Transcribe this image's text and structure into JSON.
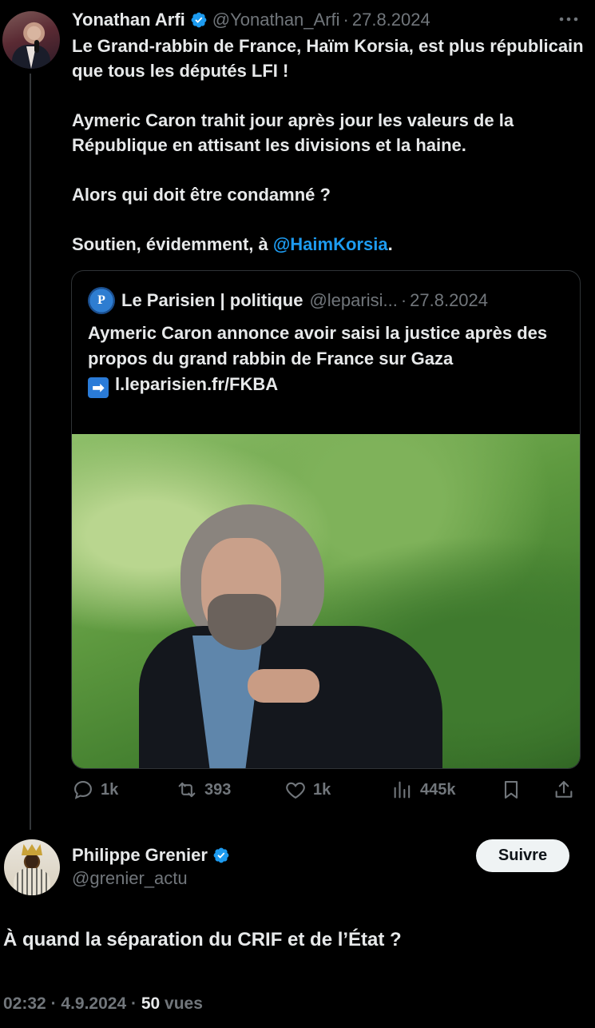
{
  "main_tweet": {
    "author_name": "Yonathan Arfi",
    "author_handle": "@Yonathan_Arfi",
    "separator": "·",
    "date": "27.8.2024",
    "more_icon": "more-horizontal-icon",
    "text_line1": "Le Grand-rabbin de France, Haïm Korsia, est plus républicain que tous les députés LFI !",
    "text_line2": "Aymeric Caron trahit jour après jour les valeurs de la République en attisant les divisions et la haine.",
    "text_line3": "Alors  qui doit être condamné ?",
    "text_line4_prefix": "Soutien, évidemment, à ",
    "text_line4_mention": "@HaimKorsia",
    "text_line4_suffix": "."
  },
  "quoted_tweet": {
    "logo_letter": "P",
    "author_name": "Le Parisien | politique",
    "author_handle": "@leparisi...",
    "separator": "·",
    "date": "27.8.2024",
    "text": "Aymeric Caron annonce avoir saisi la justice après des propos du grand rabbin de France sur Gaza",
    "arrow_emoji": "➡",
    "link": "l.leparisien.fr/FKBA"
  },
  "actions": {
    "replies": "1k",
    "retweets": "393",
    "likes": "1k",
    "views": "445k"
  },
  "reply_tweet": {
    "author_name": "Philippe Grenier",
    "author_handle": "@grenier_actu",
    "follow_label": "Suivre",
    "text": "À quand la séparation du CRIF et de l’État ?",
    "time": "02:32",
    "separator": "·",
    "date": "4.9.2024",
    "views_count": "50",
    "views_label": "vues"
  },
  "colors": {
    "background": "#000000",
    "text": "#e7e9ea",
    "muted": "#71767b",
    "link": "#1d9bf0",
    "verified": "#1d9bf0"
  }
}
